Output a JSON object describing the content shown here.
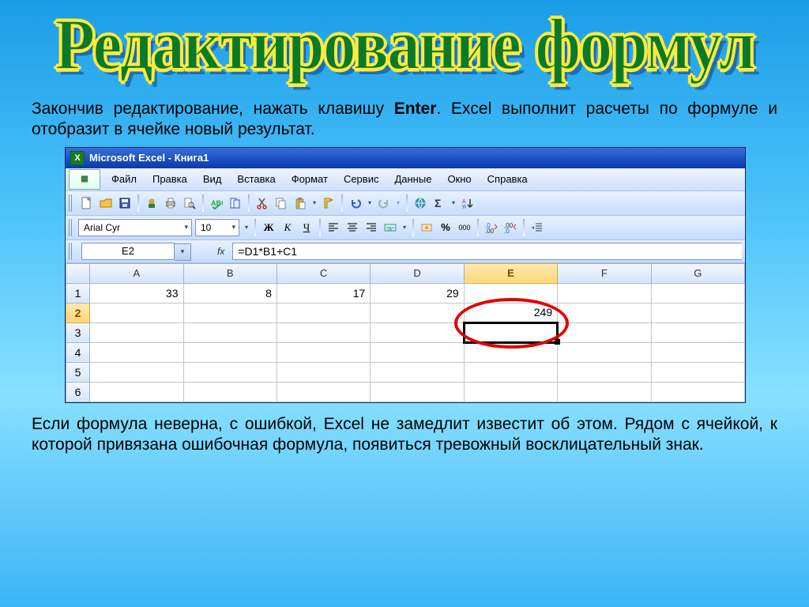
{
  "slide": {
    "title": "Редактирование формул",
    "paragraph1_before": "Закончив редактирование, нажать клавишу ",
    "paragraph1_bold": "Enter",
    "paragraph1_after": ". Excel выполнит расчеты по формуле и отобразит в ячейке новый результат.",
    "paragraph2": "Если формула неверна, с ошибкой, Excel не замедлит  известит об этом. Рядом с ячейкой, к которой привязана ошибочная формула, появиться тревожный восклицательный знак."
  },
  "excel": {
    "title": "Microsoft Excel - Книга1",
    "menu": [
      "Файл",
      "Правка",
      "Вид",
      "Вставка",
      "Формат",
      "Сервис",
      "Данные",
      "Окно",
      "Справка"
    ],
    "font_name": "Arial Cyr",
    "font_size": "10",
    "format_buttons": {
      "bold": "Ж",
      "italic": "К",
      "underline": "Ч"
    },
    "percent": "%",
    "thousands": "000",
    "name_box": "E2",
    "fx_label": "fx",
    "formula": "=D1*B1+C1",
    "columns": [
      "A",
      "B",
      "C",
      "D",
      "E",
      "F",
      "G"
    ],
    "rows": [
      "1",
      "2",
      "3",
      "4",
      "5",
      "6"
    ],
    "data": {
      "A1": "33",
      "B1": "8",
      "C1": "17",
      "D1": "29",
      "E2": "249"
    },
    "selected_cell": "E2"
  }
}
